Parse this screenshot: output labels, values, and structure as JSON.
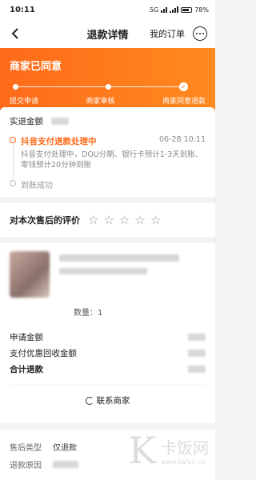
{
  "status_bar": {
    "time": "10:11",
    "network": "5G",
    "battery": "78%"
  },
  "nav": {
    "title": "退款详情",
    "orders": "我的订单"
  },
  "banner": {
    "status": "商家已同意",
    "steps": [
      "提交申请",
      "商家审核",
      "商家同意退款"
    ]
  },
  "refund": {
    "label": "实退金额",
    "timeline": {
      "title": "抖音支付退款处理中",
      "time": "06-28 10:11",
      "desc": "抖音支付处理中，DOU分期、银行卡预计1-3天到账、零钱预计20分钟到账",
      "done": "到账成功"
    }
  },
  "rating": {
    "label": "对本次售后的评价",
    "stars": [
      "☆",
      "☆",
      "☆",
      "☆",
      "☆"
    ]
  },
  "product": {
    "qty": "数量：1",
    "rows": [
      "申请金额",
      "支付优惠回收金额",
      "合计退款"
    ]
  },
  "contact": {
    "label": "联系商家"
  },
  "after_sale": {
    "type_label": "售后类型",
    "type_value": "仅退款",
    "reason_label": "退款原因"
  },
  "watermark": {
    "logo": "K",
    "name": "卡饭网",
    "url": "www.kafan.cn"
  },
  "colors": {
    "accent": "#ff6a1a"
  }
}
